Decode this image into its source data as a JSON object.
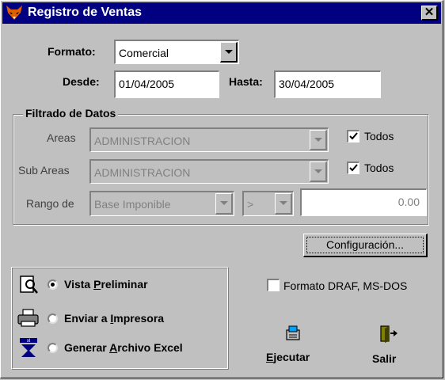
{
  "window": {
    "title": "Registro de Ventas",
    "icon": "fox-icon"
  },
  "form": {
    "formato_label": "Formato:",
    "formato_value": "Comercial",
    "desde_label": "Desde:",
    "desde_value": "01/04/2005",
    "hasta_label": "Hasta:",
    "hasta_value": "30/04/2005"
  },
  "filtrado": {
    "title": "Filtrado de Datos",
    "areas_label": "Areas",
    "areas_value": "ADMINISTRACION",
    "areas_todos_label": "Todos",
    "areas_todos_checked": true,
    "subareas_label": "Sub Areas",
    "subareas_value": "ADMINISTRACION",
    "subareas_todos_label": "Todos",
    "subareas_todos_checked": true,
    "rango_label": "Rango de",
    "rango_field": "Base Imponible",
    "rango_operator": ">",
    "rango_amount": "0.00"
  },
  "configuracion_button": "Configuración...",
  "output": {
    "vista_pre": "Vista ",
    "vista_u": "P",
    "vista_post": "reliminar",
    "imp_pre": "Enviar a ",
    "imp_u": "I",
    "imp_post": "mpresora",
    "excel_pre": "Generar ",
    "excel_u": "A",
    "excel_post": "rchivo Excel",
    "selected": "vista"
  },
  "formato_draf_label": "Formato DRAF, MS-DOS",
  "formato_draf_checked": false,
  "ejecutar_u": "E",
  "ejecutar_rest": "jecutar",
  "salir_label": "Salir"
}
